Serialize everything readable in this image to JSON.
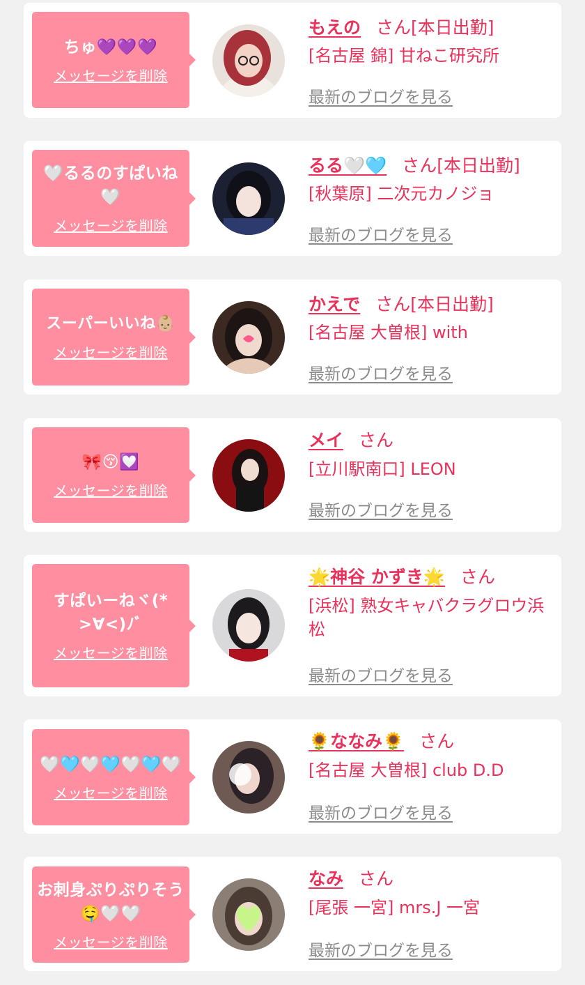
{
  "colors": {
    "accent": "#e8315b",
    "bubble": "#ff8fa0",
    "background": "#f1f1f1",
    "link_gray": "#8b8b8b"
  },
  "labels": {
    "delete": "メッセージを削除",
    "blog": "最新のブログを見る",
    "san": "さん"
  },
  "items": [
    {
      "message": "ちゅ💜💜💜",
      "name": "もえの",
      "status": "[本日出勤]",
      "shop": "[名古屋 錦] 甘ねこ研究所"
    },
    {
      "message": "🤍るるのすぱいね🤍",
      "name": "るる🤍🩵",
      "status": "[本日出勤]",
      "shop": "[秋葉原] 二次元カノジョ"
    },
    {
      "message": "スーパーいいね👶🏼",
      "name": "かえで",
      "status": "[本日出勤]",
      "shop": "[名古屋 大曽根] with"
    },
    {
      "message": "🎀😚💟",
      "name": "メイ",
      "status": "",
      "shop": "[立川駅南口] LEON"
    },
    {
      "message": "すぱいーねヾ(*>∀<)ﾉﾞ",
      "name": "🌟神谷 かずき🌟",
      "status": "",
      "shop": "[浜松] 熟女キャバクラグロウ浜松"
    },
    {
      "message": "🤍🩵🤍🩵🤍🩵🤍",
      "name": "🌻ななみ🌻",
      "status": "",
      "shop": "[名古屋 大曽根] club D.D"
    },
    {
      "message": "お刺身ぷりぷりそう🤤🤍🤍",
      "name": "なみ",
      "status": "",
      "shop": "[尾張 一宮] mrs.J 一宮"
    }
  ]
}
